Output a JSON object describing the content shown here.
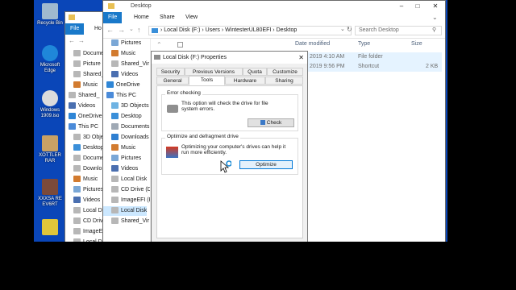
{
  "desktop": {
    "icons": [
      {
        "label": "Recycle Bin",
        "icon": "recycle-bin-icon",
        "color": "#9fb9cf"
      },
      {
        "label": "Microsoft Edge",
        "icon": "edge-icon",
        "color": "#1f87d9"
      },
      {
        "label": "Windows 1909.iso",
        "icon": "disc-image-icon",
        "color": "#dcdcdc"
      },
      {
        "label": "XOTTLER RAR",
        "icon": "archive-icon",
        "color": "#c8a165"
      },
      {
        "label": "XXXSA RE EV6RT",
        "icon": "app-icon",
        "color": "#7b4a3a"
      }
    ]
  },
  "explorer": {
    "title": "Desktop",
    "tabs": {
      "file": "File",
      "home": "Home",
      "share": "Share",
      "view": "View"
    },
    "breadcrumb": [
      "Local Disk (F:)",
      "Users",
      "WintesterUL80EFI",
      "Desktop"
    ],
    "search_placeholder": "Search Desktop",
    "columns": {
      "date": "Date modified",
      "type": "Type",
      "size": "Size"
    },
    "files": [
      {
        "date": "2019 4:10 AM",
        "type": "File folder",
        "size": ""
      },
      {
        "date": "2019 9:56 PM",
        "type": "Shortcut",
        "size": "2 KB"
      }
    ],
    "nav_items": [
      "Pictures",
      "Music",
      "Shared_Vir",
      "Videos",
      "OneDrive",
      "This PC",
      "3D Objects",
      "Desktop",
      "Documents",
      "Downloads",
      "Music",
      "Pictures",
      "Videos",
      "Local Disk",
      "CD Drive (D",
      "ImageEFI (E",
      "Local Disk",
      "Shared_Vir"
    ]
  },
  "back_window": {
    "tabs": {
      "file": "File",
      "home": "Ho"
    },
    "nav_items": [
      "Docume",
      "Picture",
      "Shared_",
      "Music",
      "Shared_",
      "Videos",
      "OneDrive",
      "This PC",
      "3D Obje",
      "Desktop",
      "Docume",
      "Downlo",
      "Music",
      "Pictures",
      "Videos",
      "Local Di",
      "CD Drive",
      "ImageEF",
      "Local Di"
    ]
  },
  "dialog": {
    "title": "Local Disk (F:) Properties",
    "tabs_row1": [
      "Security",
      "Previous Versions",
      "Quota",
      "Customize"
    ],
    "tabs_row2": [
      "General",
      "Tools",
      "Hardware",
      "Sharing"
    ],
    "error_checking": {
      "label": "Error checking",
      "text": "This option will check the drive for file system errors.",
      "button": "Check"
    },
    "optimize": {
      "label": "Optimize and defragment drive",
      "text": "Optimizing your computer's drives can help it run more efficiently.",
      "button": "Optimize"
    }
  }
}
